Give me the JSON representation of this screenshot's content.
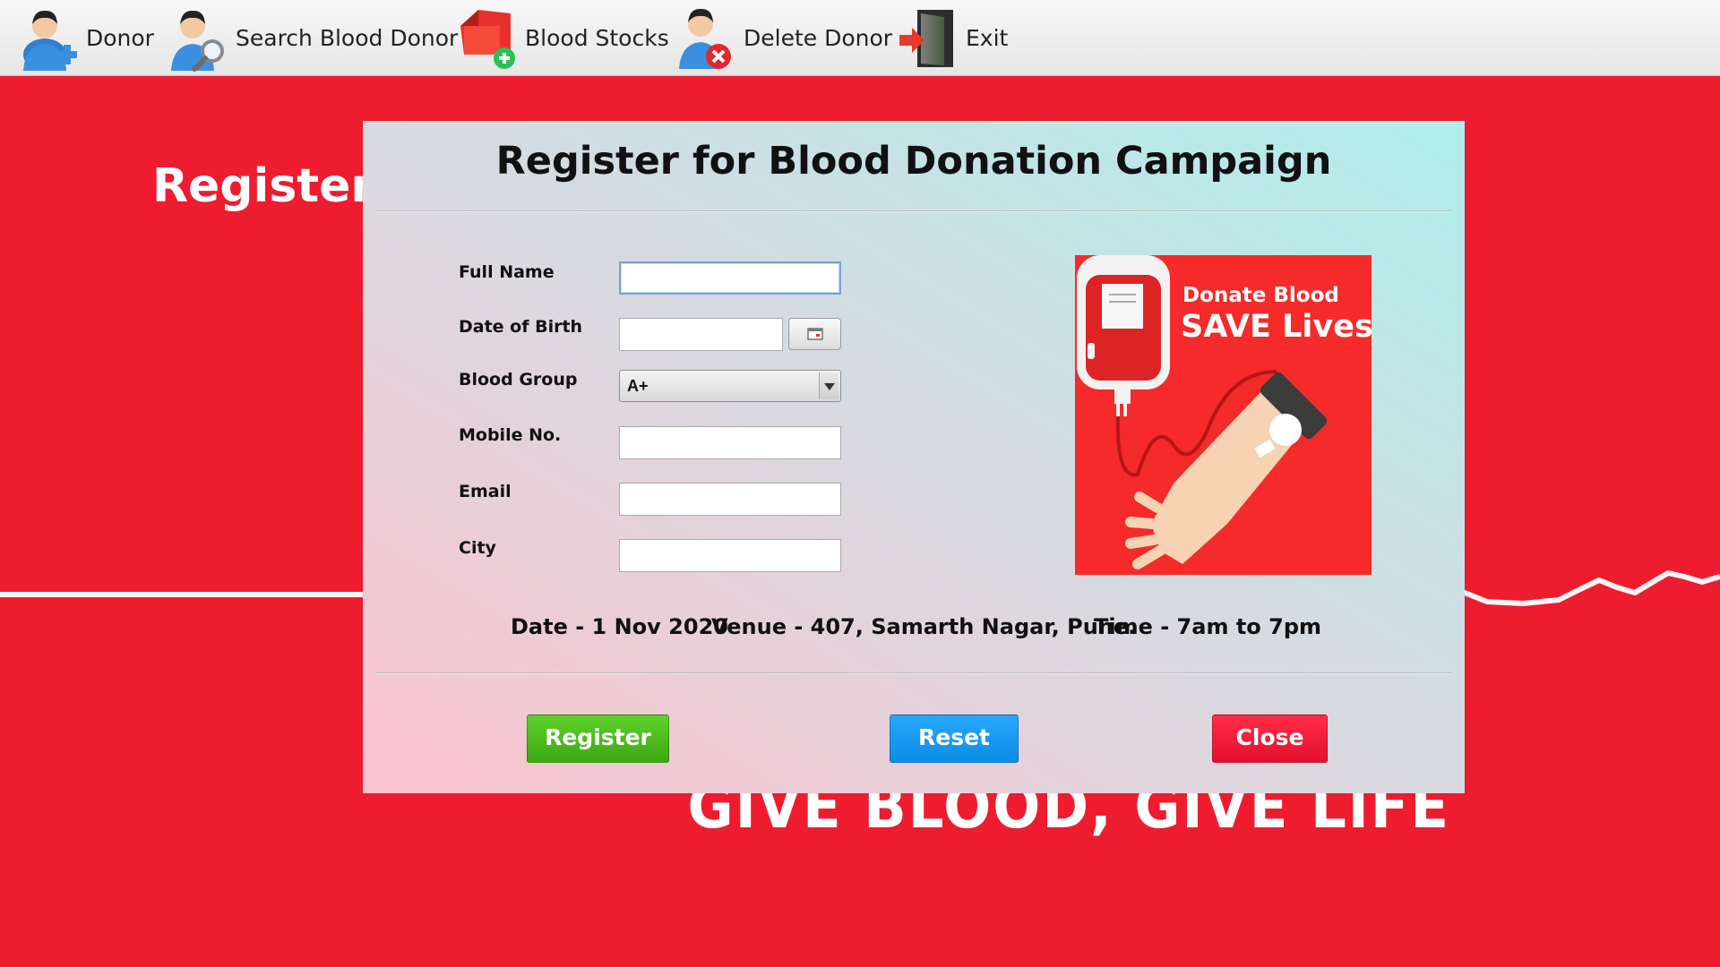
{
  "toolbar": {
    "items": [
      {
        "label": "Donor",
        "icon": "add-user-icon"
      },
      {
        "label": "Search Blood Donor",
        "icon": "search-user-icon"
      },
      {
        "label": "Blood Stocks",
        "icon": "blood-stock-add-icon"
      },
      {
        "label": "Delete Donor",
        "icon": "delete-user-icon"
      },
      {
        "label": "Exit",
        "icon": "exit-door-icon"
      }
    ]
  },
  "background": {
    "heading": "Register fo",
    "slogan": "GIVE BLOOD, GIVE LIFE"
  },
  "dialog": {
    "title": "Register for Blood Donation Campaign",
    "fields": {
      "full_name": {
        "label": "Full Name",
        "value": ""
      },
      "dob": {
        "label": "Date of Birth",
        "value": ""
      },
      "blood_group": {
        "label": "Blood Group",
        "value": "A+"
      },
      "mobile": {
        "label": "Mobile No.",
        "value": ""
      },
      "email": {
        "label": "Email",
        "value": ""
      },
      "city": {
        "label": "City",
        "value": ""
      }
    },
    "poster": {
      "line1": "Donate Blood",
      "line2": "SAVE Lives"
    },
    "info": {
      "date": "Date - 1 Nov 2020",
      "venue": "Venue - 407, Samarth Nagar, Pune.",
      "time": "Time - 7am to 7pm"
    },
    "buttons": {
      "register": "Register",
      "reset": "Reset",
      "close": "Close"
    }
  },
  "colors": {
    "background_red": "#ee1c2f",
    "register_green": "#4cbf1d",
    "reset_blue": "#1a9af5",
    "close_red": "#f51a3a"
  }
}
